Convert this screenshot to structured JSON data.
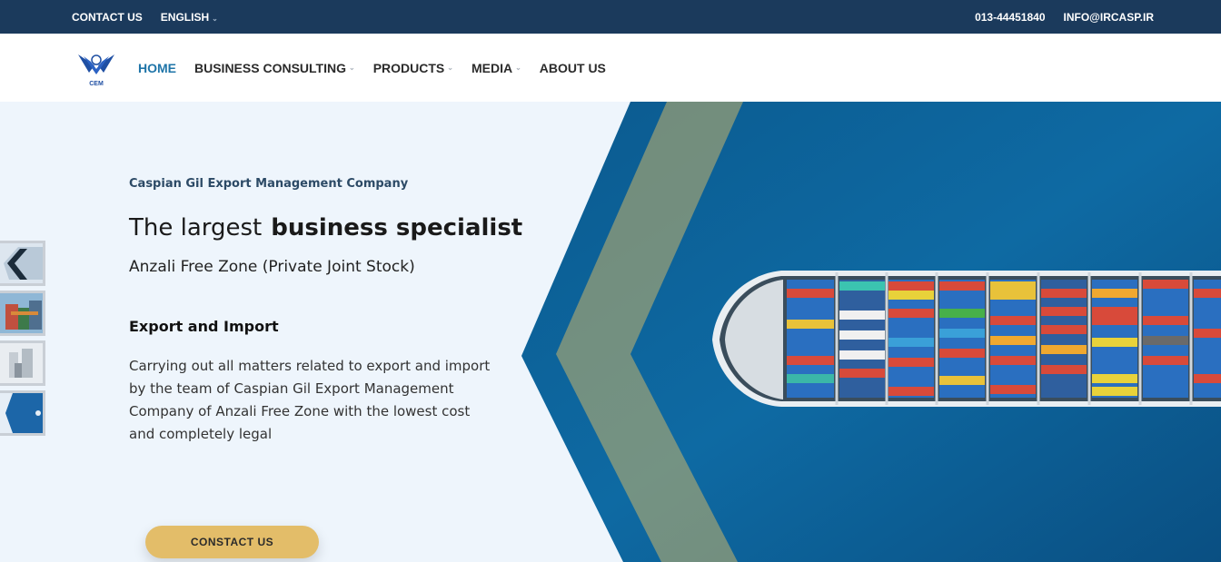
{
  "topbar": {
    "contact": "CONTACT US",
    "language": "ENGLISH",
    "phone": "013-44451840",
    "email": "INFO@IRCASP.IR"
  },
  "logo": {
    "text": "CEM"
  },
  "nav": {
    "items": [
      {
        "label": "HOME",
        "active": true,
        "dropdown": false
      },
      {
        "label": "BUSINESS CONSULTING",
        "active": false,
        "dropdown": true
      },
      {
        "label": "PRODUCTS",
        "active": false,
        "dropdown": true
      },
      {
        "label": "MEDIA",
        "active": false,
        "dropdown": true
      },
      {
        "label": "ABOUT US",
        "active": false,
        "dropdown": false
      }
    ]
  },
  "hero": {
    "company": "Caspian Gil Export Management Company",
    "headline_light": "The largest",
    "headline_bold": "business specialist",
    "subheadline": "Anzali Free Zone (Private Joint Stock)",
    "section_title": "Export and Import",
    "paragraph": "Carrying out all matters related to export and import by the team of Caspian Gil Export Management Company of Anzali Free Zone with the lowest cost and completely legal",
    "cta": "CONSTACT US"
  },
  "colors": {
    "topbar": "#1b3a5c",
    "accent": "#1e74a8",
    "button": "#e3bd69",
    "sea": "#0d5f94"
  }
}
